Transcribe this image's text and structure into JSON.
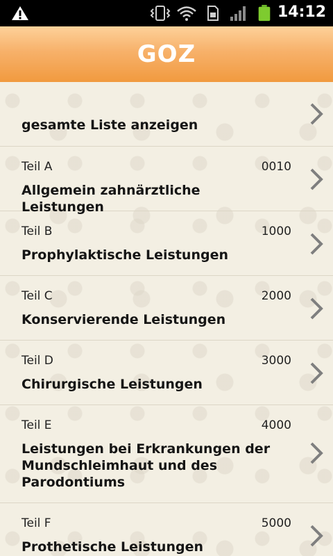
{
  "status": {
    "time": "14:12"
  },
  "header": {
    "title": "GOZ"
  },
  "list": {
    "all_label": "gesamte Liste anzeigen",
    "items": [
      {
        "part": "Teil A",
        "code": "0010",
        "title": "Allgemein zahnärztliche Leistungen"
      },
      {
        "part": "Teil B",
        "code": "1000",
        "title": "Prophylaktische Leistungen"
      },
      {
        "part": "Teil C",
        "code": "2000",
        "title": "Konservierende Leistungen"
      },
      {
        "part": "Teil D",
        "code": "3000",
        "title": "Chirurgische Leistungen"
      },
      {
        "part": "Teil E",
        "code": "4000",
        "title": "Leistungen bei Erkrankungen der Mundschleimhaut und des Parodontiums"
      },
      {
        "part": "Teil F",
        "code": "5000",
        "title": "Prothetische Leistungen"
      }
    ]
  },
  "colors": {
    "accent": "#f7a94f",
    "chevron": "#7f7f7f"
  }
}
